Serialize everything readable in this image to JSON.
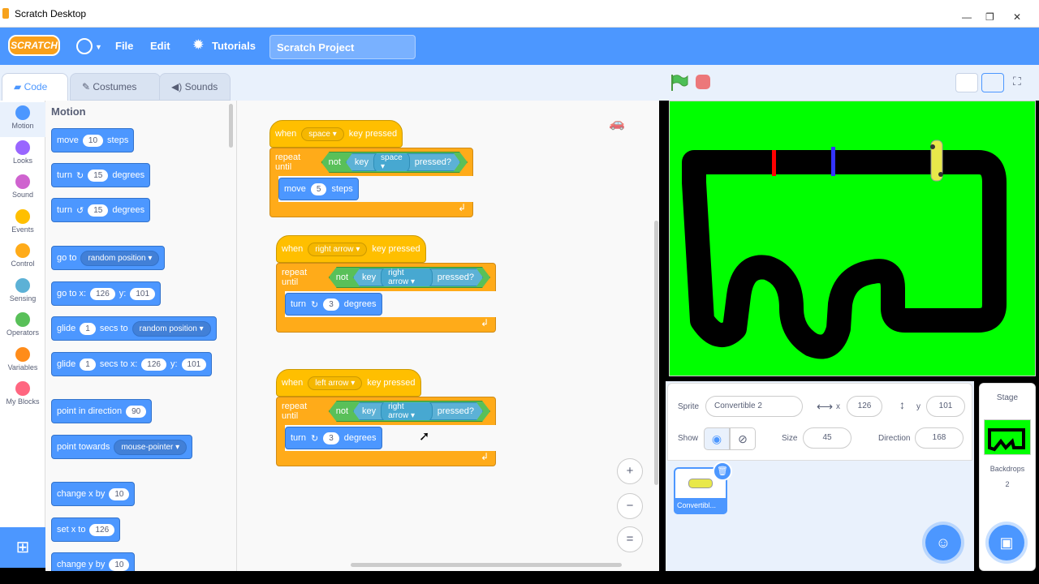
{
  "window": {
    "title": "Scratch Desktop"
  },
  "menubar": {
    "logo": "SCRATCH",
    "file": "File",
    "edit": "Edit",
    "tutorials": "Tutorials",
    "project_name": "Scratch Project"
  },
  "tabs": [
    {
      "label": "Code"
    },
    {
      "label": "Costumes"
    },
    {
      "label": "Sounds"
    }
  ],
  "categories": [
    {
      "label": "Motion",
      "color": "#4c97ff"
    },
    {
      "label": "Looks",
      "color": "#9966ff"
    },
    {
      "label": "Sound",
      "color": "#cf63cf"
    },
    {
      "label": "Events",
      "color": "#ffbf00"
    },
    {
      "label": "Control",
      "color": "#ffab19"
    },
    {
      "label": "Sensing",
      "color": "#5cb1d6"
    },
    {
      "label": "Operators",
      "color": "#59c059"
    },
    {
      "label": "Variables",
      "color": "#ff8c1a"
    },
    {
      "label": "My Blocks",
      "color": "#ff6680"
    }
  ],
  "palette": {
    "title": "Motion",
    "move": {
      "a": "move",
      "v": "10",
      "b": "steps"
    },
    "turn_cw": {
      "a": "turn",
      "v": "15",
      "b": "degrees"
    },
    "turn_ccw": {
      "a": "turn",
      "v": "15",
      "b": "degrees"
    },
    "goto": {
      "a": "go to",
      "d": "random position"
    },
    "gotoxy": {
      "a": "go to x:",
      "x": "126",
      "y_lbl": "y:",
      "y": "101"
    },
    "glide1": {
      "a": "glide",
      "v": "1",
      "b": "secs to",
      "d": "random position"
    },
    "glide2": {
      "a": "glide",
      "v": "1",
      "b": "secs to x:",
      "x": "126",
      "y_lbl": "y:",
      "y": "101"
    },
    "point_dir": {
      "a": "point in direction",
      "v": "90"
    },
    "point_towards": {
      "a": "point towards",
      "d": "mouse-pointer"
    },
    "change_x": {
      "a": "change x by",
      "v": "10"
    },
    "set_x": {
      "a": "set x to",
      "v": "126"
    },
    "change_y": {
      "a": "change y by",
      "v": "10"
    }
  },
  "scripts": [
    {
      "when": "when",
      "key": "space",
      "pressed": "key pressed",
      "repeat": "repeat until",
      "not": "not",
      "key_lbl": "key",
      "cond_key": "space",
      "cond_pressed": "pressed?",
      "inner_a": "move",
      "inner_v": "5",
      "inner_b": "steps"
    },
    {
      "when": "when",
      "key": "right arrow",
      "pressed": "key pressed",
      "repeat": "repeat until",
      "not": "not",
      "key_lbl": "key",
      "cond_key": "right arrow",
      "cond_pressed": "pressed?",
      "inner_a": "turn",
      "inner_v": "3",
      "inner_b": "degrees"
    },
    {
      "when": "when",
      "key": "left arrow",
      "pressed": "key pressed",
      "repeat": "repeat until",
      "not": "not",
      "key_lbl": "key",
      "cond_key": "right arrow",
      "cond_pressed": "pressed?",
      "inner_a": "turn",
      "inner_v": "3",
      "inner_b": "degrees"
    }
  ],
  "sprite": {
    "sprite_lbl": "Sprite",
    "name": "Convertible 2",
    "x_lbl": "x",
    "x": "126",
    "y_lbl": "y",
    "y": "101",
    "show_lbl": "Show",
    "size_lbl": "Size",
    "size": "45",
    "direction_lbl": "Direction",
    "direction": "168",
    "thumb_label": "Convertibl..."
  },
  "stage_pane": {
    "title": "Stage",
    "backdrops_lbl": "Backdrops",
    "backdrops": "2"
  }
}
